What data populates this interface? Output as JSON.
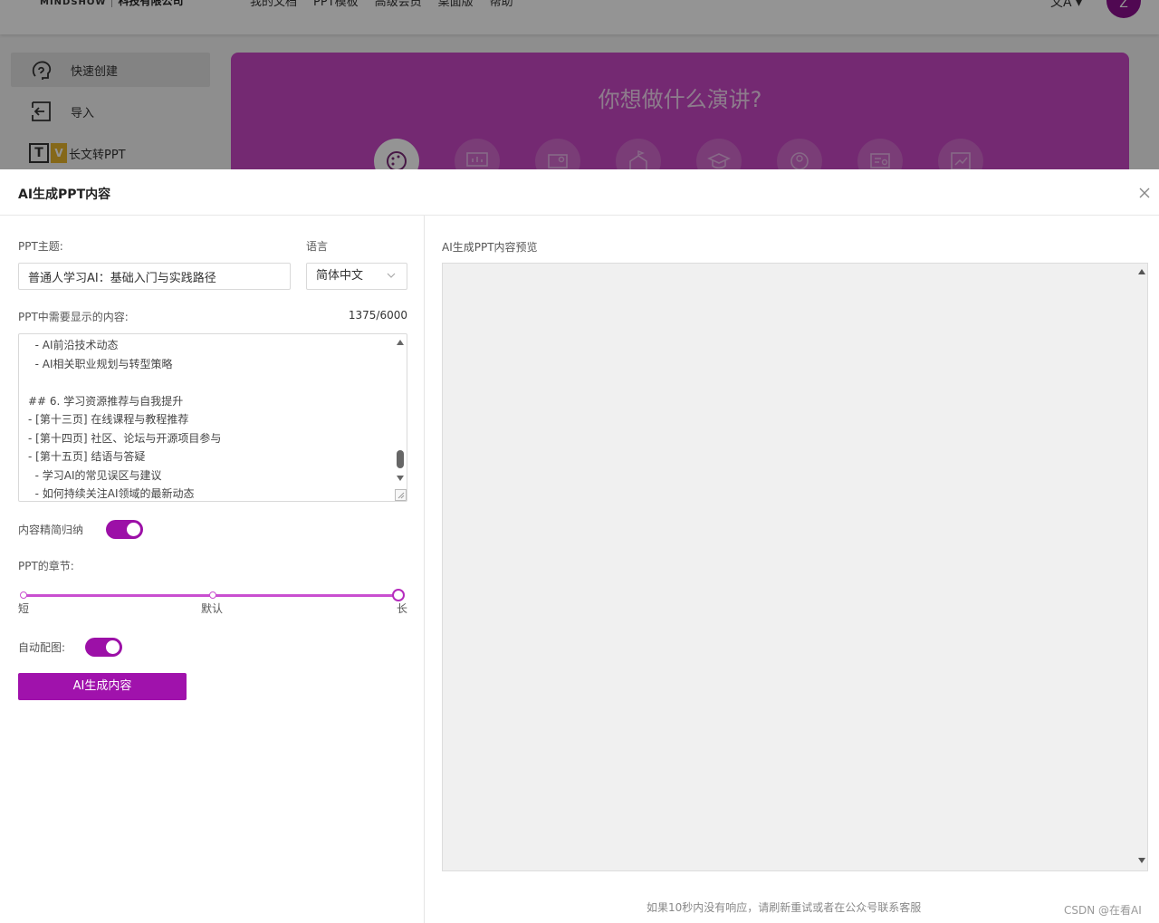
{
  "background": {
    "logo_mark": "MINDSHOW",
    "company": "科技有限公司",
    "nav": [
      "我的文档",
      "PPT模板",
      "高级会员",
      "桌面版",
      "帮助"
    ],
    "translate_icon": "translate-icon",
    "avatar_initial": "Z",
    "sidebar": [
      {
        "label": "快速创建",
        "icon": "brain-icon"
      },
      {
        "label": "导入",
        "icon": "import-icon"
      },
      {
        "label": "长文转PPT",
        "icon": "text-to-ppt-icon"
      }
    ],
    "hero_title": "你想做什么演讲?",
    "hero_icons": [
      "creative-icon",
      "presentation-icon",
      "report-icon",
      "education-icon",
      "graduation-icon",
      "team-icon",
      "certificate-icon",
      "chart-icon"
    ],
    "accent": "#c948c4"
  },
  "modal": {
    "title": "AI生成PPT内容",
    "topic_label": "PPT主题:",
    "topic_value": "普通人学习AI：基础入门与实践路径",
    "language_label": "语言",
    "language_value": "简体中文",
    "content_label": "PPT中需要显示的内容:",
    "char_count": "1375/6000",
    "content_lines": [
      "  - AI前沿技术动态",
      "  - AI相关职业规划与转型策略",
      "",
      "## 6. 学习资源推荐与自我提升",
      "- [第十三页] 在线课程与教程推荐",
      "- [第十四页] 社区、论坛与开源项目参与",
      "- [第十五页] 结语与答疑",
      "  - 学习AI的常见误区与建议",
      "  - 如何持续关注AI领域的最新动态"
    ],
    "summarize_label": "内容精简归纳",
    "summarize_on": true,
    "chapters_label": "PPT的章节:",
    "chapter_levels": [
      "短",
      "默认",
      "长"
    ],
    "chapter_selected": "长",
    "auto_image_label": "自动配图:",
    "auto_image_on": true,
    "generate_label": "AI生成内容",
    "preview_label": "AI生成PPT内容预览",
    "hint": "如果10秒内没有响应，请刷新重试或者在公众号联系客服",
    "accent": "#a012ac"
  },
  "watermark": "CSDN @在看AI"
}
